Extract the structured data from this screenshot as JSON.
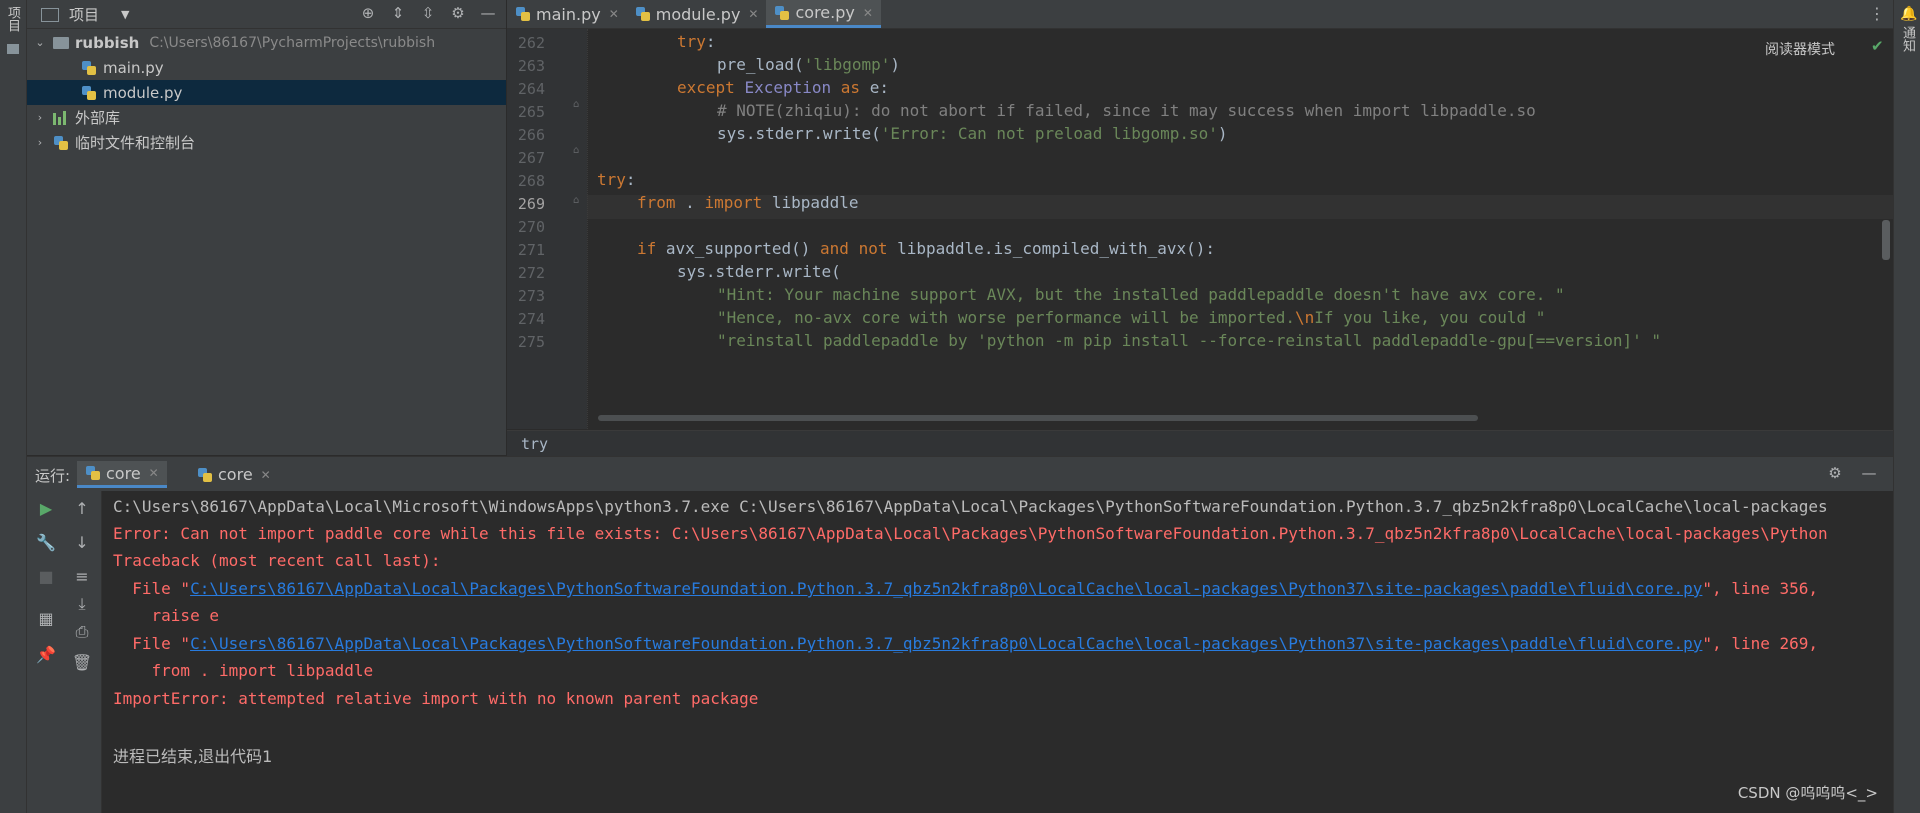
{
  "left_strip": {
    "label": "项目"
  },
  "right_strip": {
    "label": "通知"
  },
  "project": {
    "title": "项目",
    "tree": [
      {
        "label": "rubbish",
        "path": "C:\\Users\\86167\\PycharmProjects\\rubbish"
      },
      {
        "label": "main.py"
      },
      {
        "label": "module.py"
      },
      {
        "label": "外部库"
      },
      {
        "label": "临时文件和控制台"
      }
    ]
  },
  "tabs": [
    {
      "label": "main.py"
    },
    {
      "label": "module.py"
    },
    {
      "label": "core.py"
    }
  ],
  "editor": {
    "reader_mode": "阅读器模式",
    "line_numbers": [
      "262",
      "263",
      "264",
      "265",
      "266",
      "267",
      "268",
      "269",
      "270",
      "271",
      "272",
      "273",
      "274",
      "275"
    ],
    "lines": {
      "l262_kw": "try",
      "l262_rest": ":",
      "l263_a": "pre_load(",
      "l263_str": "'libgomp'",
      "l263_b": ")",
      "l264_kw": "except",
      "l264_bl": "Exception",
      "l264_as": "as",
      "l264_rest": "e:",
      "l265_cm": "# NOTE(zhiqiu): do not abort if failed, since it may success when import libpaddle.so",
      "l266_a": "sys.stderr.write(",
      "l266_str": "'Error: Can not preload libgomp.so'",
      "l266_b": ")",
      "l268_kw": "try",
      "l268_rest": ":",
      "l269_kw1": "from",
      "l269_mid": " . ",
      "l269_kw2": "import",
      "l269_rest": " libpaddle",
      "l271_kw": "if",
      "l271_a": " avx_supported() ",
      "l271_and": "and",
      "l271_not": "not",
      "l271_b": " libpaddle.is_compiled_with_avx():",
      "l272": "sys.stderr.write(",
      "l273_str": "\"Hint: Your machine support AVX, but the installed paddlepaddle doesn't have avx core. \"",
      "l274_str1": "\"Hence, no-avx core with worse performance will be imported.",
      "l274_esc": "\\n",
      "l274_str2": "If you like, you could \"",
      "l275_str": "\"reinstall paddlepaddle by 'python -m pip install --force-reinstall paddlepaddle-gpu[==version]' \""
    }
  },
  "breadcrumb": "try",
  "run": {
    "label": "运行:",
    "tabs": [
      {
        "label": "core"
      },
      {
        "label": "core"
      }
    ],
    "console": {
      "l1": "C:\\Users\\86167\\AppData\\Local\\Microsoft\\WindowsApps\\python3.7.exe C:\\Users\\86167\\AppData\\Local\\Packages\\PythonSoftwareFoundation.Python.3.7_qbz5n2kfra8p0\\LocalCache\\local-packages",
      "l2": "Error: Can not import paddle core while this file exists: C:\\Users\\86167\\AppData\\Local\\Packages\\PythonSoftwareFoundation.Python.3.7_qbz5n2kfra8p0\\LocalCache\\local-packages\\Python",
      "l3": "Traceback (most recent call last):",
      "l4_pre": "  File \"",
      "l4_link": "C:\\Users\\86167\\AppData\\Local\\Packages\\PythonSoftwareFoundation.Python.3.7_qbz5n2kfra8p0\\LocalCache\\local-packages\\Python37\\site-packages\\paddle\\fluid\\core.py",
      "l4_post": "\", line 356,",
      "l5": "    raise e",
      "l6_pre": "  File \"",
      "l6_link": "C:\\Users\\86167\\AppData\\Local\\Packages\\PythonSoftwareFoundation.Python.3.7_qbz5n2kfra8p0\\LocalCache\\local-packages\\Python37\\site-packages\\paddle\\fluid\\core.py",
      "l6_post": "\", line 269,",
      "l7": "    from . import libpaddle",
      "l8": "ImportError: attempted relative import with no known parent package",
      "l9": "进程已结束,退出代码1"
    }
  },
  "watermark": "CSDN @呜呜呜<_>"
}
